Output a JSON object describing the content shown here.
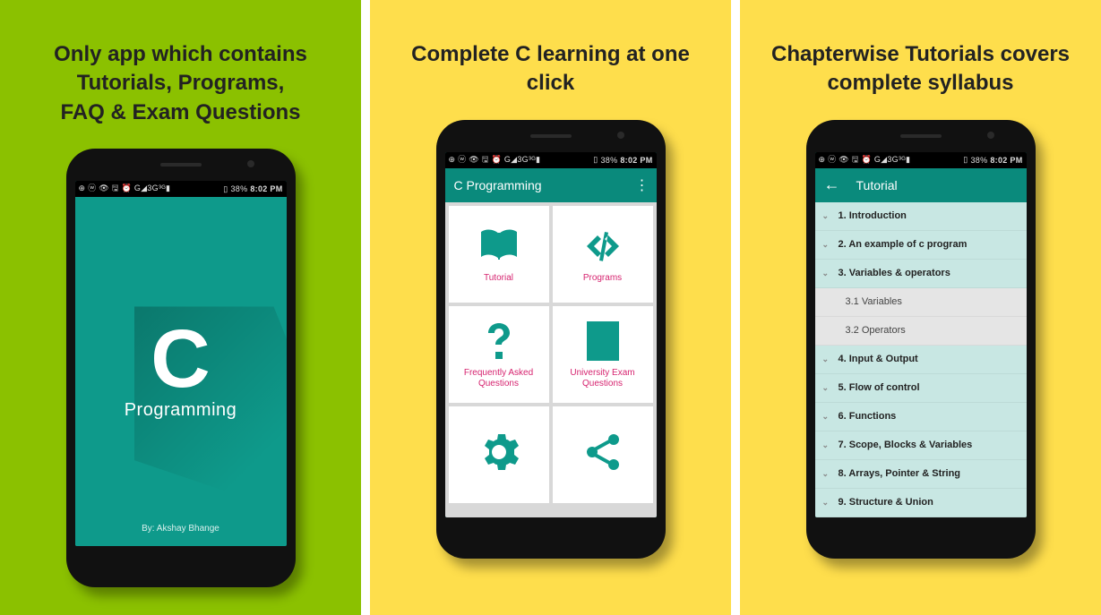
{
  "status": {
    "left_icons": "⊕ ⓦ 👁 🖫 ⏰  G◢3G³ᴳ▮",
    "battery": "38%",
    "time": "8:02 PM"
  },
  "panel1": {
    "headline": "Only app which contains\nTutorials, Programs,\nFAQ & Exam Questions",
    "big_letter": "C",
    "word": "Programming",
    "byline": "By: Akshay Bhange"
  },
  "panel2": {
    "headline": "Complete C learning at one click",
    "appbar_title": "C Programming",
    "tiles": [
      {
        "id": "tutorial",
        "label": "Tutorial"
      },
      {
        "id": "programs",
        "label": "Programs"
      },
      {
        "id": "faq",
        "label": "Frequently Asked\nQuestions"
      },
      {
        "id": "exam",
        "label": "University Exam\nQuestions"
      },
      {
        "id": "settings",
        "label": ""
      },
      {
        "id": "share",
        "label": ""
      }
    ]
  },
  "panel3": {
    "headline": "Chapterwise Tutorials covers\ncomplete syllabus",
    "appbar_title": "Tutorial",
    "chapters": [
      "1. Introduction",
      "2. An example of c program",
      "3. Variables & operators"
    ],
    "subchapters": [
      "3.1 Variables",
      "3.2 Operators"
    ],
    "chapters_after": [
      "4. Input & Output",
      "5. Flow of control",
      "6. Functions",
      "7. Scope, Blocks & Variables",
      "8. Arrays, Pointer & String",
      "9. Structure & Union"
    ]
  }
}
